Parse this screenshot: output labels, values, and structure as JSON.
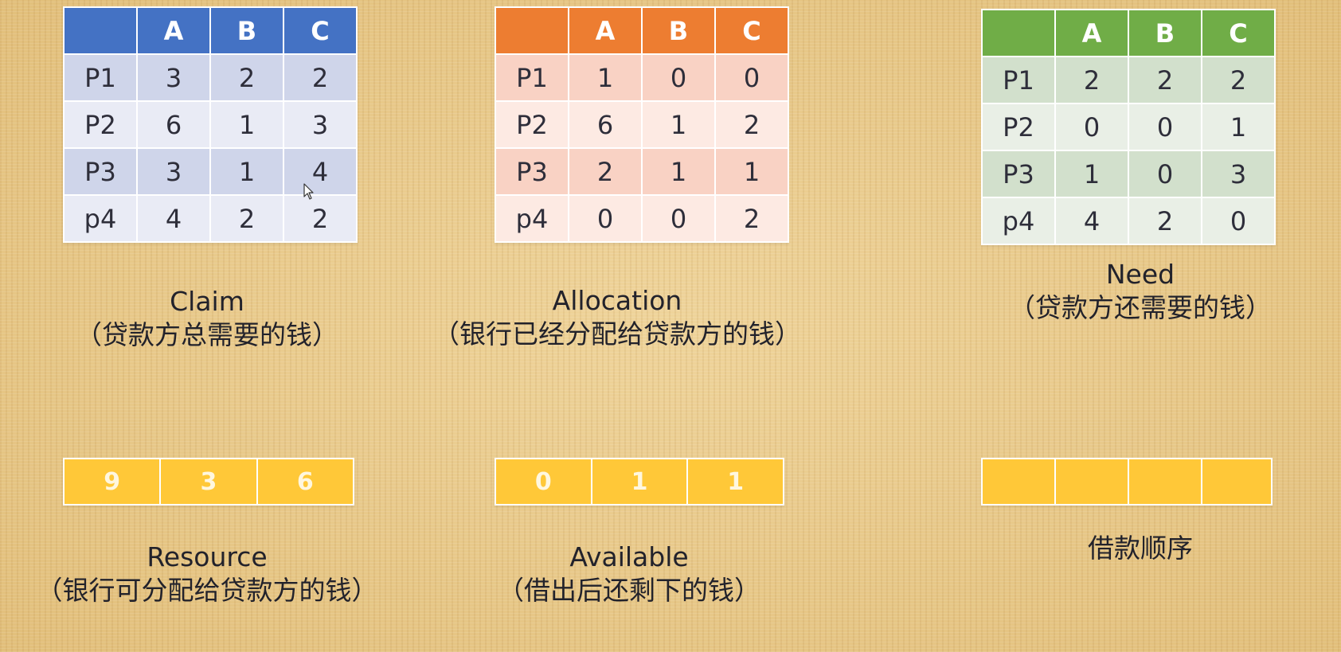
{
  "columns": [
    "A",
    "B",
    "C"
  ],
  "claim": {
    "rows": [
      {
        "label": "P1",
        "values": [
          "3",
          "2",
          "2"
        ]
      },
      {
        "label": "P2",
        "values": [
          "6",
          "1",
          "3"
        ]
      },
      {
        "label": "P3",
        "values": [
          "3",
          "1",
          "4"
        ]
      },
      {
        "label": "p4",
        "values": [
          "4",
          "2",
          "2"
        ]
      }
    ],
    "caption_title": "Claim",
    "caption_sub": "（贷款方总需要的钱）",
    "header_color": "#4472c4"
  },
  "allocation": {
    "rows": [
      {
        "label": "P1",
        "values": [
          "1",
          "0",
          "0"
        ]
      },
      {
        "label": "P2",
        "values": [
          "6",
          "1",
          "2"
        ]
      },
      {
        "label": "P3",
        "values": [
          "2",
          "1",
          "1"
        ]
      },
      {
        "label": "p4",
        "values": [
          "0",
          "0",
          "2"
        ]
      }
    ],
    "caption_title": "Allocation",
    "caption_sub": "（银行已经分配给贷款方的钱）",
    "header_color": "#ed7d31"
  },
  "need": {
    "rows": [
      {
        "label": "P1",
        "values": [
          "2",
          "2",
          "2"
        ]
      },
      {
        "label": "P2",
        "values": [
          "0",
          "0",
          "1"
        ]
      },
      {
        "label": "P3",
        "values": [
          "1",
          "0",
          "3"
        ]
      },
      {
        "label": "p4",
        "values": [
          "4",
          "2",
          "0"
        ]
      }
    ],
    "caption_title": "Need",
    "caption_sub": "（贷款方还需要的钱）",
    "header_color": "#70ad47"
  },
  "resource": {
    "values": [
      "9",
      "3",
      "6"
    ],
    "caption_title": "Resource",
    "caption_sub": "（银行可分配给贷款方的钱）"
  },
  "available": {
    "values": [
      "0",
      "1",
      "1"
    ],
    "caption_title": "Available",
    "caption_sub": "（借出后还剩下的钱）"
  },
  "order": {
    "values": [
      "",
      "",
      "",
      ""
    ],
    "caption_title": "借款顺序"
  },
  "colors": {
    "vector_fill": "#ffc838",
    "background": "#e8c98a"
  }
}
